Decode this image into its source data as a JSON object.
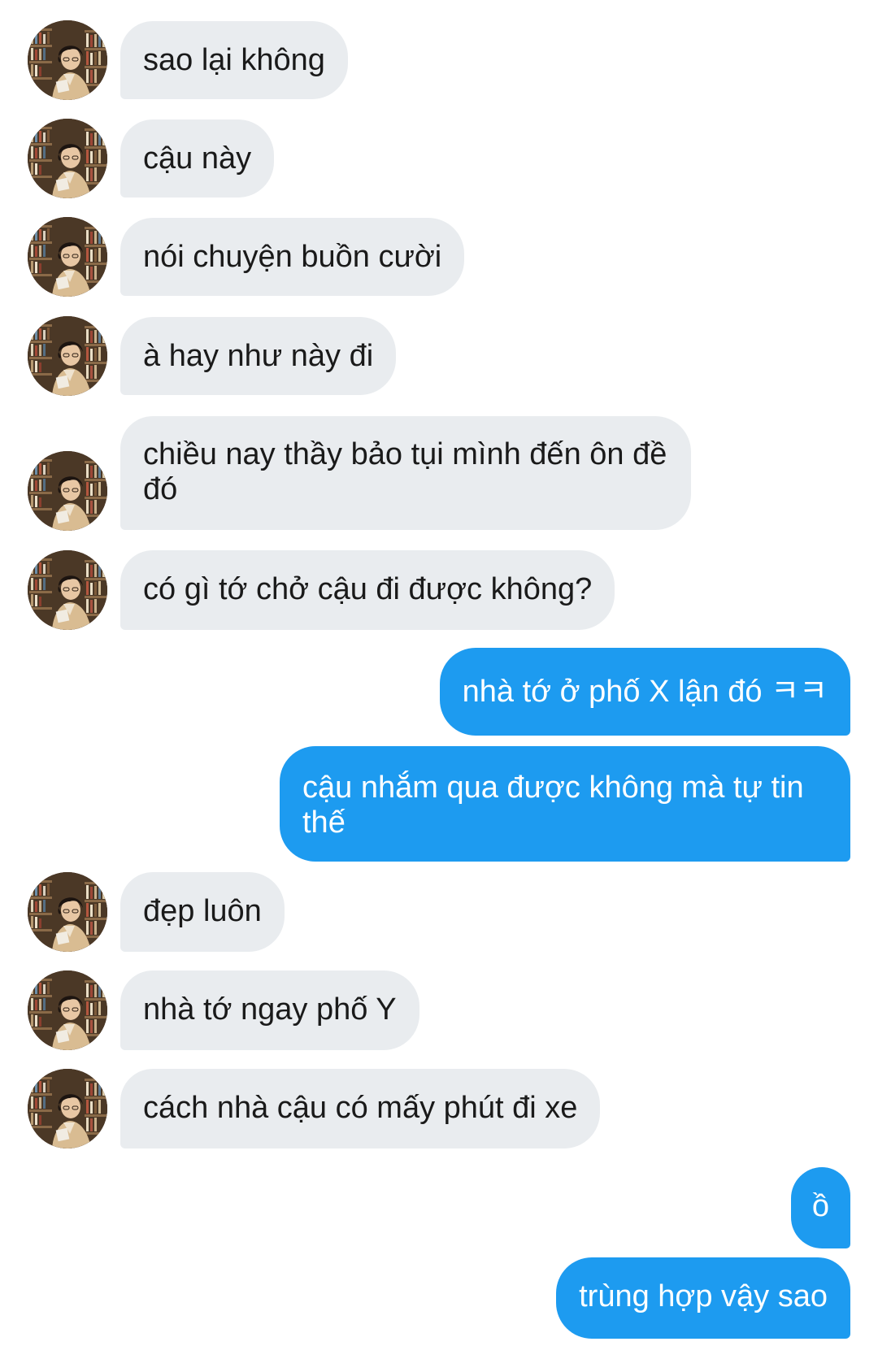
{
  "conversation": {
    "messages": [
      {
        "sender": "other",
        "text": "sao lại không"
      },
      {
        "sender": "other",
        "text": "cậu này"
      },
      {
        "sender": "other",
        "text": "nói chuyện buồn cười"
      },
      {
        "sender": "other",
        "text": "à hay như này đi"
      },
      {
        "sender": "other",
        "text": "chiều nay thầy bảo tụi mình đến ôn đề đó"
      },
      {
        "sender": "other",
        "text": "có gì tớ chở cậu đi được không?"
      },
      {
        "sender": "me",
        "text": "nhà tớ ở phố X lận đó ㅋㅋ"
      },
      {
        "sender": "me",
        "text": "cậu nhắm qua được không mà tự tin thế"
      },
      {
        "sender": "other",
        "text": "đẹp luôn"
      },
      {
        "sender": "other",
        "text": "nhà tớ ngay phố Y"
      },
      {
        "sender": "other",
        "text": "cách nhà cậu có mấy phút đi xe"
      },
      {
        "sender": "me",
        "text": "ồ"
      },
      {
        "sender": "me",
        "text": "trùng hợp vậy sao"
      }
    ]
  },
  "colors": {
    "incoming_bubble": "#e9ecef",
    "outgoing_bubble": "#1d9bf0",
    "incoming_text": "#1a1a1a",
    "outgoing_text": "#ffffff"
  },
  "icons": {
    "avatar": "contact-avatar-photo"
  }
}
